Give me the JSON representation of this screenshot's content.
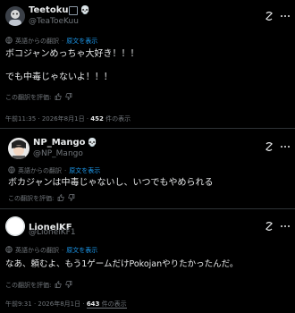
{
  "post1": {
    "name": "Teetoku",
    "handle": "@TeaToeKuu",
    "translated_label": "英語からの翻訳",
    "show_original": "原文を表示",
    "lines": [
      "ボコジャンめっちゃ大好き！！！",
      "でも中毒じゃないよ！！！"
    ],
    "rate_label": "この翻訳を評価:",
    "time": "午前11:35 · 2026年8月1日",
    "views_count": "452",
    "views_label": "件の表示"
  },
  "post2": {
    "name": "NP_Mango",
    "handle": "@NP_Mango",
    "translated_label": "英語からの翻訳",
    "show_original": "原文を表示",
    "text": "ボカジャンは中毒じゃないし、いつでもやめられる",
    "rate_label": "この翻訳を評価:"
  },
  "post3": {
    "name": "LionelKF",
    "handle": "@LionelKF1",
    "translated_label": "英語からの翻訳",
    "show_original": "原文を表示",
    "text": "なあ、頼むよ、もう1ゲームだけPokojanやりたかったんだ。",
    "rate_label": "この翻訳を評価:",
    "time": "午前9:31 · 2026年8月1日",
    "views_count": "643",
    "views_label": "件の表示"
  },
  "icons": {
    "grok": "grok-icon",
    "more": "more-options-icon",
    "globe": "globe-icon",
    "thumbs_up": "thumbs-up-icon",
    "thumbs_down": "thumbs-down-icon",
    "skull": "skull-emoji",
    "verified_square": "square-badge"
  },
  "colors": {
    "background": "#000000",
    "text_primary": "#e7e9ea",
    "text_secondary": "#71767b",
    "link": "#1d9bf0",
    "divider": "#2f3336"
  }
}
